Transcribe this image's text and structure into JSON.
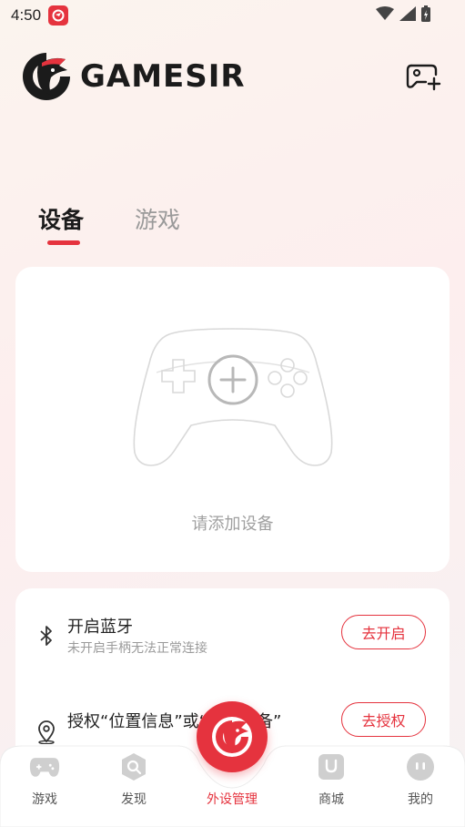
{
  "status_bar": {
    "time": "4:50",
    "icons": [
      "app-notification-icon",
      "wifi-icon",
      "signal-icon",
      "battery-charging-icon"
    ]
  },
  "header": {
    "brand": "GAMESIR",
    "logo_icon": "gamesir-eagle-logo",
    "action_icon": "add-controller-icon"
  },
  "tabs": [
    {
      "label": "设备",
      "active": true
    },
    {
      "label": "游戏",
      "active": false
    }
  ],
  "device_card": {
    "illustration_icon": "controller-add-icon",
    "label": "请添加设备"
  },
  "permissions": [
    {
      "icon": "bluetooth-icon",
      "title": "开启蓝牙",
      "subtitle": "未开启手柄无法正常连接",
      "button": "去开启"
    },
    {
      "icon": "location-icon",
      "title": "授权“位置信息”或“附近设备”",
      "subtitle": "",
      "button": "去授权"
    }
  ],
  "bottom_nav": [
    {
      "label": "游戏",
      "icon": "gamepad-icon",
      "active": false
    },
    {
      "label": "发现",
      "icon": "discover-icon",
      "active": false
    },
    {
      "label": "外设管理",
      "icon": "gamesir-eagle-icon",
      "active": true
    },
    {
      "label": "商城",
      "icon": "shop-icon",
      "active": false
    },
    {
      "label": "我的",
      "icon": "profile-icon",
      "active": false
    }
  ],
  "colors": {
    "accent": "#e5333e",
    "text_primary": "#1b1b1b",
    "text_muted": "#9a9a9a",
    "nav_icon": "#c8c8c8"
  }
}
